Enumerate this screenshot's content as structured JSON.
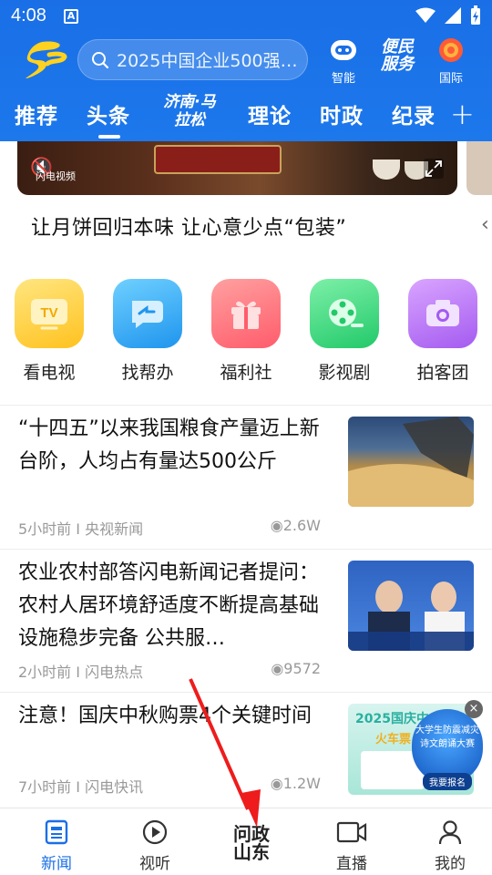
{
  "status": {
    "time": "4:08",
    "a_badge": "A"
  },
  "header": {
    "search_placeholder": "2025中国企业500强…",
    "icons": [
      {
        "label": "智能"
      },
      {
        "label": "便民服务"
      },
      {
        "label": "国际"
      }
    ]
  },
  "tabs": [
    {
      "label": "推荐"
    },
    {
      "label": "头条",
      "active": true
    },
    {
      "label": "济南·马拉松"
    },
    {
      "label": "理论"
    },
    {
      "label": "时政"
    },
    {
      "label": "纪录"
    }
  ],
  "banner": {
    "caption": "闪电视频"
  },
  "headline": "让月饼回归本味 让心意少点“包装”",
  "shortcuts": [
    {
      "label": "看电视",
      "color": "#ffcf3f"
    },
    {
      "label": "找帮办",
      "color": "#3aa8f2"
    },
    {
      "label": "福利社",
      "color": "#ff6b6b"
    },
    {
      "label": "影视剧",
      "color": "#3fd77f"
    },
    {
      "label": "拍客团",
      "color": "#b06bf2"
    }
  ],
  "news": [
    {
      "title": "“十四五”以来我国粮食产量迈上新台阶，人均占有量达500公斤",
      "meta": "5小时前 I  央视新闻",
      "views": "2.6W"
    },
    {
      "title": "农业农村部答闪电新闻记者提问：农村人居环境舒适度不断提高基础设施稳步完备 公共服…",
      "meta": "2小时前 I  闪电热点",
      "views": "9572"
    },
    {
      "title": "注意！国庆中秋购票4个关键时间",
      "meta": "7小时前 I  闪电快讯",
      "views": "1.2W"
    }
  ],
  "thumb3": {
    "year_title": "2025国庆中",
    "subtitle": "火车票"
  },
  "float_badge": {
    "line1": "大学生防震减灾",
    "line2": "诗文朗诵大赛",
    "btn": "我要报名"
  },
  "bottom_nav": [
    {
      "label": "新闻",
      "active": true
    },
    {
      "label": "视听"
    },
    {
      "label": "问政山东"
    },
    {
      "label": "直播"
    },
    {
      "label": "我的"
    }
  ],
  "colors": {
    "brand_blue": "#1a6fe6",
    "arrow_red": "#ee1c1c"
  }
}
